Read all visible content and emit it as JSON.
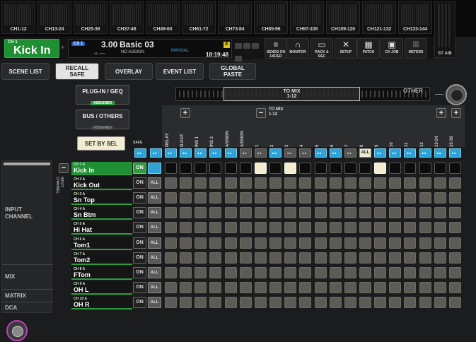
{
  "meter_bridge": {
    "groups": [
      "CH1-12",
      "CH13-24",
      "CH25-36",
      "CH37-48",
      "CH49-60",
      "CH61-72",
      "CH73-84",
      "CH85-96",
      "CH97-108",
      "CH109-120",
      "CH121-132",
      "CH133-144"
    ],
    "stereo_label": "ST A/B"
  },
  "status_bar": {
    "channel_number": "CH 1",
    "channel_name": "Kick In",
    "cs_badge": "CS 1",
    "scene_number": "3.00",
    "scene_title": "Basic 03",
    "scene_arrows": "›› —",
    "assign_text": "NO ASSIGN",
    "mode_text": "MANUAL",
    "clock": "18:19:48",
    "e_badge": "E",
    "tools": [
      {
        "id": "sends-on-fader",
        "icon": "sends-icon",
        "glyph": "≡",
        "label": "SENDS ON FADER"
      },
      {
        "id": "monitor",
        "icon": "headphones-icon",
        "glyph": "∩",
        "label": "MONITOR"
      },
      {
        "id": "rack-rec",
        "icon": "rack-icon",
        "glyph": "▭",
        "label": "RACK & REC"
      },
      {
        "id": "setup",
        "icon": "tools-icon",
        "glyph": "✕",
        "label": "SETUP"
      },
      {
        "id": "patch",
        "icon": "patch-icon",
        "glyph": "▦",
        "label": "PATCH"
      },
      {
        "id": "ch-job",
        "icon": "toolbox-icon",
        "glyph": "▣",
        "label": "CH JOB"
      },
      {
        "id": "meters",
        "icon": "meters-icon",
        "glyph": "▥",
        "label": "METERS"
      }
    ]
  },
  "tabs": [
    {
      "id": "scene-list",
      "label": "SCENE LIST",
      "active": false
    },
    {
      "id": "recall-safe",
      "label": "RECALL\nSAFE",
      "active": true
    },
    {
      "id": "overlay",
      "label": "OVERLAY",
      "active": false
    },
    {
      "id": "event-list",
      "label": "EVENT LIST",
      "active": false
    },
    {
      "id": "global-paste",
      "label": "GLOBAL\nPASTE",
      "active": false
    }
  ],
  "buttons": {
    "plugin_geq": {
      "label": "PLUG-IN / GEQ",
      "status": "ASSIGNED"
    },
    "bus_others": {
      "label": "BUS / OTHERS",
      "status": "ASSIGNED"
    },
    "set_by_sel": "SET BY SEL"
  },
  "navigator": {
    "window_label": "TO MIX",
    "window_range": "1-12",
    "other_label": "OTHER"
  },
  "column_header": {
    "group_label": "TO MIX\n1-12",
    "safe_label": "SAFE",
    "columns": [
      "DELAY",
      "D.OUT",
      "INS 1",
      "INS 2",
      "DCA\nASSIGN",
      "MUTE\nASSIGN",
      "TO MIX\n1",
      "TO MIX\n2",
      "TO MIX\n3",
      "TO MIX\n4",
      "TO MIX\n5",
      "TO MIX\n6",
      "TO MIX\n7",
      "TO MIX\n8",
      "TO MIX\n9",
      "TO MIX\n10",
      "TO MIX\n11",
      "TO MIX\n12",
      "TO MIX\n13-24",
      "TO MIX\n25-36"
    ],
    "top_buttons": [
      "cyan",
      "cyan",
      "cyan",
      "cyan",
      "cyan",
      "cyan",
      "cyan",
      "dim",
      "dim",
      "cyan",
      "dim",
      "dim",
      "cyan",
      "cyan",
      "dim",
      "ALL",
      "cyan",
      "cyan",
      "cyan",
      "cyan",
      "cyan",
      "cyan"
    ]
  },
  "left_panel": {
    "input_channel": "INPUT\nCHANNEL",
    "mix": "MIX",
    "matrix": "MATRIX",
    "dca": "DCA",
    "vertical_label": "INPUT\nCHANNEL"
  },
  "channels": [
    {
      "num": "CH 1 A",
      "name": "Kick In",
      "on": "ON",
      "safe": "",
      "selected": true
    },
    {
      "num": "CH 2 A",
      "name": "Kick Out",
      "on": "ON",
      "safe": "ALL",
      "selected": false
    },
    {
      "num": "CH 3 A",
      "name": "Sn Top",
      "on": "ON",
      "safe": "ALL",
      "selected": false
    },
    {
      "num": "CH 4 A",
      "name": "Sn Btm",
      "on": "ON",
      "safe": "ALL",
      "selected": false
    },
    {
      "num": "CH 5 A",
      "name": "Hi Hat",
      "on": "ON",
      "safe": "ALL",
      "selected": false
    },
    {
      "num": "CH 6 A",
      "name": "Tom1",
      "on": "ON",
      "safe": "ALL",
      "selected": false
    },
    {
      "num": "CH 7 A",
      "name": "Tom2",
      "on": "ON",
      "safe": "ALL",
      "selected": false
    },
    {
      "num": "CH 8 A",
      "name": "FTom",
      "on": "ON",
      "safe": "ALL",
      "selected": false
    },
    {
      "num": "CH 9 A",
      "name": "OH L",
      "on": "ON",
      "safe": "ALL",
      "selected": false
    },
    {
      "num": "CH 10 A",
      "name": "OH R",
      "on": "ON",
      "safe": "ALL",
      "selected": false
    }
  ],
  "selected_row_lit_columns": [
    6,
    8,
    14
  ]
}
